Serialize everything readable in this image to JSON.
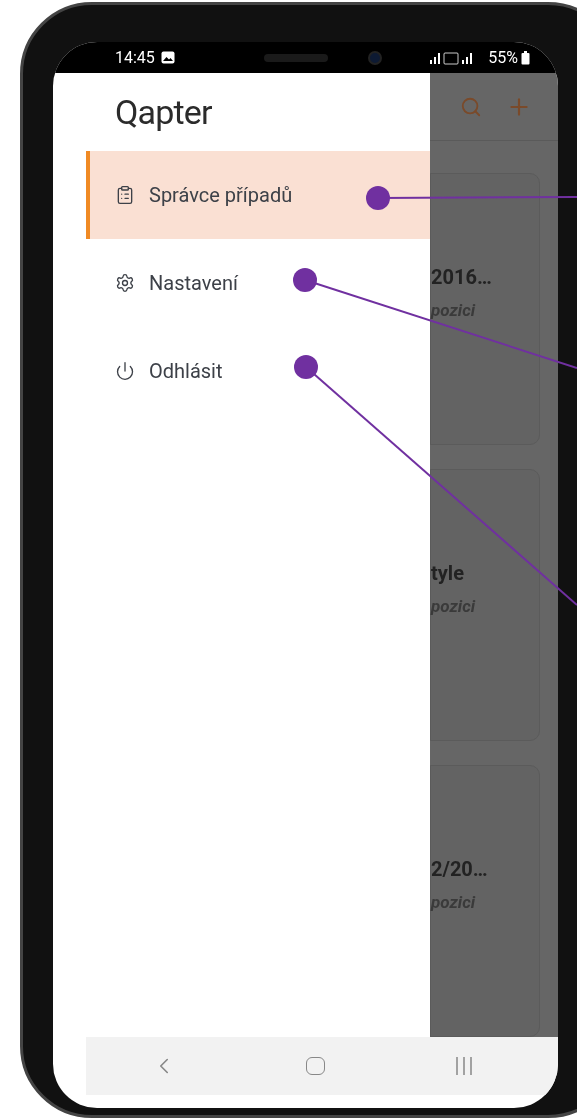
{
  "status_bar": {
    "time": "14:45",
    "battery": "55%"
  },
  "drawer": {
    "logo": "Qapter",
    "items": [
      {
        "label": "Správce případů",
        "kind": "clipboard",
        "selected": true,
        "annotated": true
      },
      {
        "label": "Nastavení",
        "kind": "gear",
        "selected": false,
        "annotated": true
      },
      {
        "label": "Odhlásit",
        "kind": "power",
        "selected": false,
        "annotated": true
      }
    ]
  },
  "background_cards": [
    {
      "title": "2016…",
      "subtitle": "pozici"
    },
    {
      "title": "tyle",
      "subtitle": "pozici"
    },
    {
      "title": "2/20…",
      "subtitle": "pozici"
    }
  ]
}
